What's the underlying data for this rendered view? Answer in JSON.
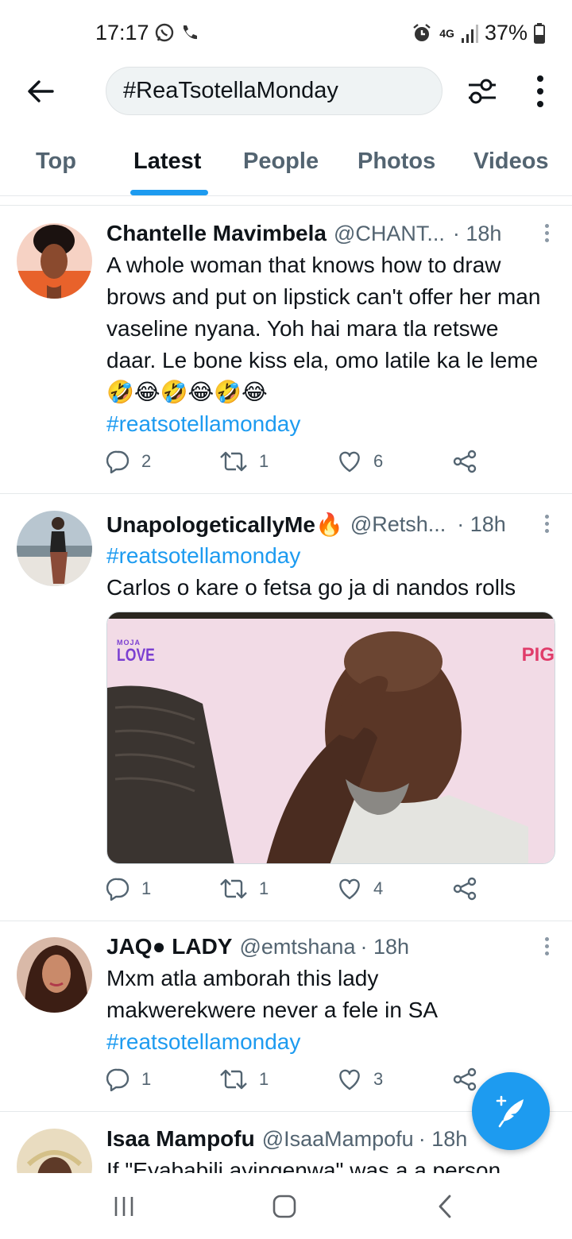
{
  "status": {
    "time": "17:17",
    "network": "4G",
    "battery": "37%"
  },
  "topbar": {
    "back_icon": "arrow-left-icon",
    "search_value": "#ReaTsotellaMonday",
    "filter_icon": "sliders-icon",
    "more_icon": "more-vertical-icon"
  },
  "tabs": [
    {
      "label": "Top",
      "active": false
    },
    {
      "label": "Latest",
      "active": true
    },
    {
      "label": "People",
      "active": false
    },
    {
      "label": "Photos",
      "active": false
    },
    {
      "label": "Videos",
      "active": false
    }
  ],
  "colors": {
    "accent": "#1d9bf0",
    "text": "#0f1419",
    "secondary": "#536471",
    "divider": "#e5e9eb"
  },
  "tweets": [
    {
      "name": "Chantelle Mavimbela",
      "handle": "@CHANT...",
      "time": "· 18h",
      "text": "A whole woman that knows how to draw brows and put on lipstick can't offer her man vaseline nyana. Yoh hai mara tla retswe daar. Le bone kiss ela, omo latile ka le leme🤣😂🤣😂🤣😂",
      "hashtag": "#reatsotellamonday",
      "replies": "2",
      "retweets": "1",
      "likes": "6"
    },
    {
      "name": "UnapologeticallyMe🔥",
      "handle": "@Retsh...",
      "time": "· 18h",
      "hashtag": "#reatsotellamonday",
      "text": "Carlos o kare o fetsa go ja di nandos rolls",
      "media_logo_top": "MOJA",
      "media_logo_bottom": "LOVE",
      "media_corner_text": "PIG",
      "replies": "1",
      "retweets": "1",
      "likes": "4"
    },
    {
      "name": "JAQ● LADY",
      "handle": "@emtshana",
      "time": "· 18h",
      "text": "Mxm atla amborah this lady makwerekwere never a fele in SA",
      "hashtag": "#reatsotellamonday",
      "replies": "1",
      "retweets": "1",
      "likes": "3"
    },
    {
      "name": "Isaa Mampofu",
      "handle": "@IsaaMampofu",
      "time": "· 18h",
      "text": "If \"Eyababili ayingenwa\" was a a person"
    }
  ],
  "fab": {
    "icon": "compose-feather-icon"
  },
  "navbar": {
    "recents_icon": "recents-icon",
    "home_icon": "home-icon",
    "back_icon": "nav-back-icon"
  }
}
